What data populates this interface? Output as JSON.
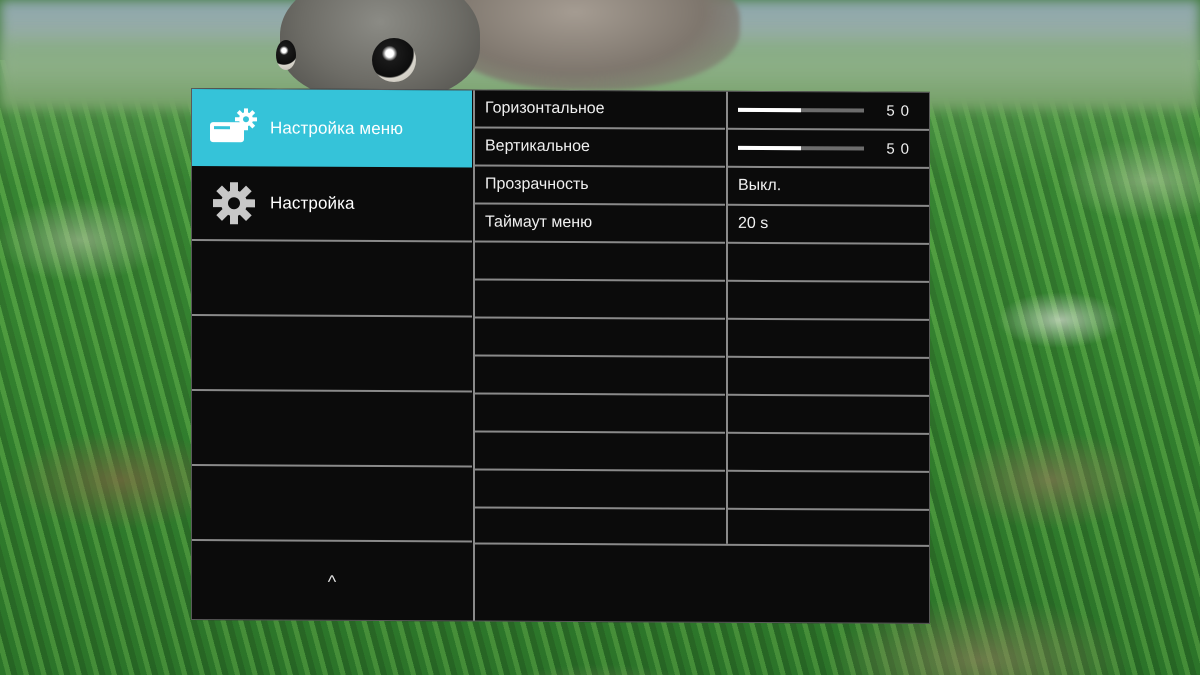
{
  "colors": {
    "accent": "#35c3d9",
    "panel": "#0b0b0b",
    "separator": "#8a8a8a",
    "text": "#ffffff"
  },
  "sidebar": {
    "items": [
      {
        "label": "Настройка меню",
        "icon": "menu-settings-icon",
        "active": true
      },
      {
        "label": "Настройка",
        "icon": "gear-icon",
        "active": false
      }
    ],
    "scroll_up_glyph": "^"
  },
  "settings": [
    {
      "label": "Горизонтальное",
      "type": "slider",
      "value": 50,
      "value_text": "50"
    },
    {
      "label": "Вертикальное",
      "type": "slider",
      "value": 50,
      "value_text": "50"
    },
    {
      "label": "Прозрачность",
      "type": "text",
      "value_text": "Выкл."
    },
    {
      "label": "Таймаут меню",
      "type": "text",
      "value_text": "20 s"
    }
  ]
}
